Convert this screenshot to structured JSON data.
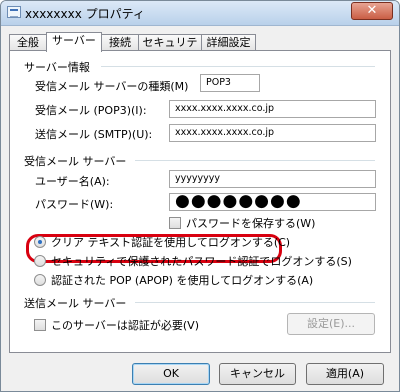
{
  "window": {
    "title": "xxxxxxxx プロパティ",
    "close_symbol": "✕"
  },
  "tabs": [
    {
      "label": "全般",
      "active": false
    },
    {
      "label": "サーバー",
      "active": true
    },
    {
      "label": "接続",
      "active": false
    },
    {
      "label": "セキュリティ",
      "active": false
    },
    {
      "label": "詳細設定",
      "active": false
    }
  ],
  "server_info": {
    "section_title": "サーバー情報",
    "incoming_type_label": "受信メール サーバーの種類(M)",
    "incoming_type_value": "POP3",
    "pop3_label": "受信メール (POP3)(I):",
    "pop3_value": "xxxx.xxxx.xxxx.co.jp",
    "smtp_label": "送信メール (SMTP)(U):",
    "smtp_value": "xxxx.xxxx.xxxx.co.jp"
  },
  "incoming_server": {
    "section_title": "受信メール サーバー",
    "username_label": "ユーザー名(A):",
    "username_value": "yyyyyyyy",
    "password_label": "パスワード(W):",
    "password_value": "●●●●●●●●",
    "save_password_label": "パスワードを保存する(W)",
    "save_password_checked": false,
    "auth_options": [
      {
        "label": "クリア テキスト認証を使用してログオンする(C)",
        "checked": true
      },
      {
        "label": "セキュリティで保護されたパスワード認証でログオンする(S)",
        "checked": false
      },
      {
        "label": "認証された POP (APOP) を使用してログオンする(A)",
        "checked": false
      }
    ]
  },
  "outgoing_server": {
    "section_title": "送信メール サーバー",
    "requires_auth_label": "このサーバーは認証が必要(V)",
    "requires_auth_checked": false,
    "settings_button": "設定(E)..."
  },
  "footer": {
    "ok": "OK",
    "cancel": "キャンセル",
    "apply": "適用(A)"
  },
  "highlight": {
    "color": "#d8000f"
  }
}
